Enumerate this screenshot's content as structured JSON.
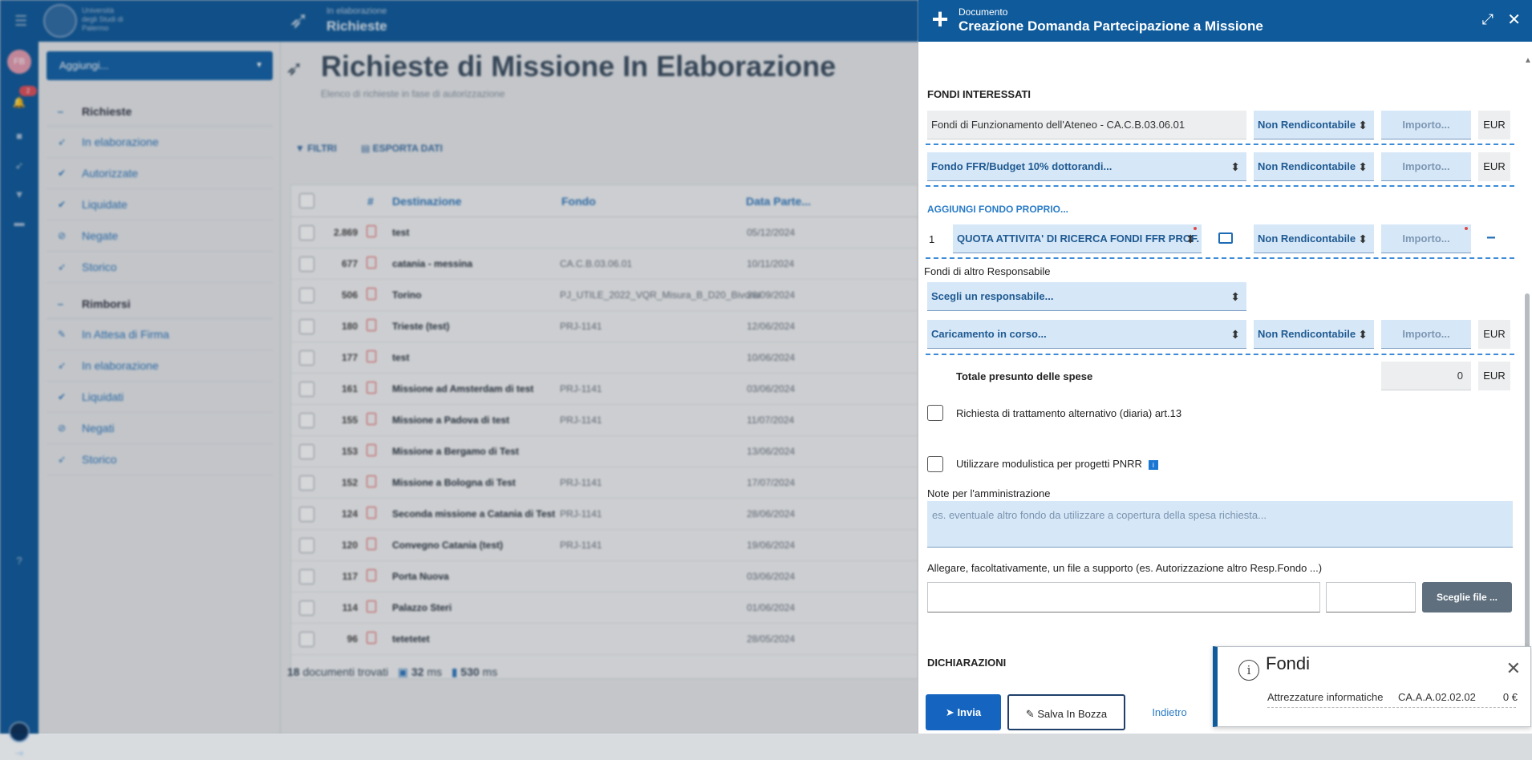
{
  "background": {
    "topbar": {
      "uni": "Università degli Studi di Palermo",
      "sub": "In elaborazione",
      "title": "Richieste"
    },
    "rail": {
      "avatar": "FB",
      "badge": "2"
    },
    "add_button": "Aggiungi...",
    "nav": {
      "richieste": {
        "header": "Richieste",
        "items": [
          "In elaborazione",
          "Autorizzate",
          "Liquidate",
          "Negate",
          "Storico"
        ]
      },
      "rimborsi": {
        "header": "Rimborsi",
        "items": [
          "In Attesa di Firma",
          "In elaborazione",
          "Liquidati",
          "Negati",
          "Storico"
        ]
      }
    },
    "page_title": "Richieste di Missione In Elaborazione",
    "page_subtitle": "Elenco di richieste in fase di autorizzazione",
    "toolbar": {
      "filters": "FILTRI",
      "export": "ESPORTA DATI"
    },
    "table": {
      "headers": {
        "num": "#",
        "dest": "Destinazione",
        "fund": "Fondo",
        "date": "Data Parte..."
      },
      "rows": [
        {
          "n": "2.869",
          "d": "test",
          "f": "",
          "dt": "05/12/2024"
        },
        {
          "n": "677",
          "d": "catania - messina",
          "f": "CA.C.B.03.06.01",
          "dt": "10/11/2024"
        },
        {
          "n": "506",
          "d": "Torino",
          "f": "PJ_UTILE_2022_VQR_Misura_B_D20_Bivona",
          "dt": "28/09/2024"
        },
        {
          "n": "180",
          "d": "Trieste (test)",
          "f": "PRJ-1141",
          "dt": "12/06/2024"
        },
        {
          "n": "177",
          "d": "test",
          "f": "",
          "dt": "10/06/2024"
        },
        {
          "n": "161",
          "d": "Missione ad Amsterdam di test",
          "f": "PRJ-1141",
          "dt": "03/06/2024"
        },
        {
          "n": "155",
          "d": "Missione a Padova di test",
          "f": "PRJ-1141",
          "dt": "11/07/2024"
        },
        {
          "n": "153",
          "d": "Missione a Bergamo di Test",
          "f": "",
          "dt": "13/06/2024"
        },
        {
          "n": "152",
          "d": "Missione a Bologna di Test",
          "f": "PRJ-1141",
          "dt": "17/07/2024"
        },
        {
          "n": "124",
          "d": "Seconda missione a Catania di Test",
          "f": "PRJ-1141",
          "dt": "28/06/2024"
        },
        {
          "n": "120",
          "d": "Convegno Catania (test)",
          "f": "PRJ-1141",
          "dt": "19/06/2024"
        },
        {
          "n": "117",
          "d": "Porta Nuova",
          "f": "",
          "dt": "03/06/2024"
        },
        {
          "n": "114",
          "d": "Palazzo Steri",
          "f": "",
          "dt": "01/06/2024"
        },
        {
          "n": "96",
          "d": "tetetetet",
          "f": "",
          "dt": "28/05/2024"
        }
      ]
    },
    "footer": {
      "count": "18",
      "count_label": "documenti trovati",
      "t1": "32",
      "t2": "530",
      "unit": "ms"
    }
  },
  "panel": {
    "doc_label": "Documento",
    "title": "Creazione Domanda Partecipazione a Missione",
    "section_funds": "FONDI INTERESSATI",
    "fund1": {
      "name": "Fondi di Funzionamento dell'Ateneo - CA.C.B.03.06.01",
      "type": "Non Rendicontabile",
      "amount_ph": "Importo...",
      "currency": "EUR"
    },
    "fund2": {
      "name": "Fondo FFR/Budget 10% dottorandi...",
      "type": "Non Rendicontabile",
      "amount_ph": "Importo...",
      "currency": "EUR"
    },
    "add_own_fund": "AGGIUNGI FONDO PROPRIO...",
    "own_fund": {
      "index": "1",
      "name": "QUOTA ATTIVITA' DI RICERCA FONDI FFR PROF. B",
      "type": "Non Rendicontabile",
      "amount_ph": "Importo...",
      "remove": "−"
    },
    "other_resp_label": "Fondi di altro Responsabile",
    "resp_select": "Scegli un responsabile...",
    "fund3": {
      "name": "Caricamento in corso...",
      "type": "Non Rendicontabile",
      "amount_ph": "Importo...",
      "currency": "EUR"
    },
    "total_label": "Totale presunto delle spese",
    "total_value": "0",
    "total_currency": "EUR",
    "chk_diaria": "Richiesta di trattamento alternativo (diaria) art.13",
    "chk_pnrr": "Utilizzare modulistica per progetti PNRR",
    "notes_label": "Note per l'amministrazione",
    "notes_placeholder": "es. eventuale altro fondo da utilizzare a copertura della spesa richiesta...",
    "attach_label": "Allegare, facoltativamente, un file a supporto (es. Autorizzazione altro Resp.Fondo ...)",
    "choose_file": "Sceglie file ...",
    "declarations": "DICHIARAZIONI",
    "btn_send": "Invia",
    "btn_draft": "Salva In Bozza",
    "btn_back": "Indietro"
  },
  "toast": {
    "title": "Fondi",
    "item": "Attrezzature informatiche",
    "code": "CA.A.A.02.02.02",
    "value": "0 €"
  }
}
